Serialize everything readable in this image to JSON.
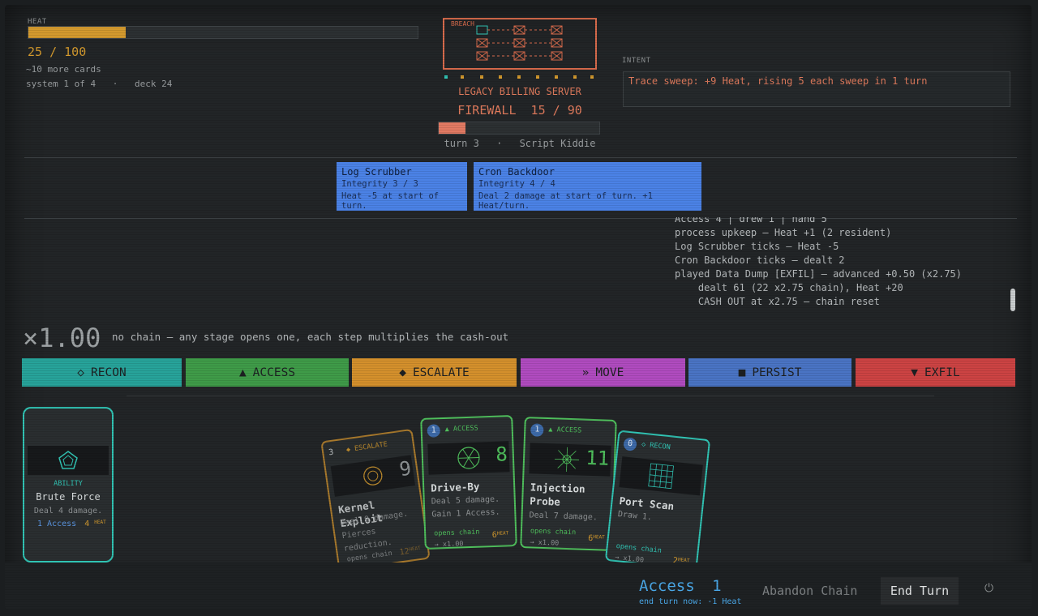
{
  "heat": {
    "label": "HEAT",
    "current": 25,
    "max": 100,
    "text": "25 / 100",
    "cards_left": "~10 more cards",
    "system": "system 1 of 4",
    "deck": "deck 24",
    "sep": "·"
  },
  "target": {
    "breach_label": "BREACH",
    "name": "LEGACY BILLING SERVER",
    "firewall_text": "FIREWALL  15 / 90",
    "firewall_current": 15,
    "firewall_max": 90,
    "turn": "turn 3",
    "difficulty": "Script Kiddie",
    "sep": "·"
  },
  "intent": {
    "label": "INTENT",
    "text": "Trace sweep: +9 Heat, rising 5 each sweep in 1 turn"
  },
  "residents": [
    {
      "name": "Log Scrubber",
      "integrity": "Integrity 3 / 3",
      "effect": "Heat -5 at start of turn."
    },
    {
      "name": "Cron Backdoor",
      "integrity": "Integrity 4 / 4",
      "effect": "Deal 2 damage at start of turn. +1 Heat/turn."
    }
  ],
  "log": [
    "Access 4 | drew 1 | hand 5",
    "process upkeep — Heat +1 (2 resident)",
    "Log Scrubber ticks — Heat -5",
    "Cron Backdoor ticks — dealt 2",
    "played Data Dump [EXFIL] — advanced +0.50 (x2.75)",
    "    dealt 61 (22 x2.75 chain), Heat +20",
    "    CASH OUT at x2.75 — chain reset"
  ],
  "chain": {
    "multiplier": "×1.00",
    "hint": "no chain — any stage opens one, each step multiplies the cash-out"
  },
  "stages": [
    {
      "icon": "◇",
      "label": "RECON",
      "color": "#27a39a"
    },
    {
      "icon": "▲",
      "label": "ACCESS",
      "color": "#3f9b48"
    },
    {
      "icon": "◆",
      "label": "ESCALATE",
      "color": "#d4902c"
    },
    {
      "icon": "»",
      "label": "MOVE",
      "color": "#b04bbf"
    },
    {
      "icon": "■",
      "label": "PERSIST",
      "color": "#4a74c4"
    },
    {
      "icon": "▼",
      "label": "EXFIL",
      "color": "#cc4343"
    }
  ],
  "ability": {
    "tag": "ABILITY",
    "name": "Brute Force",
    "desc": "Deal 4 damage.",
    "cost": "1 Access",
    "heat": "4",
    "heat_label": "HEAT"
  },
  "hand": [
    {
      "cost": "3",
      "stage": "◆ ESCALATE",
      "dmg": "9",
      "name": "Kernel Exploit",
      "desc": [
        "Deal 9 damage.",
        "Pierces",
        "reduction."
      ],
      "open": "opens chain",
      "mult": "x1.00",
      "heat": "12",
      "heat_label": "HEAT",
      "color": "#c0882e"
    },
    {
      "cost": "1",
      "stage": "▲ ACCESS",
      "dmg": "8",
      "name": "Drive-By",
      "desc": [
        "Deal 5 damage.",
        "Gain 1 Access."
      ],
      "open": "opens chain",
      "mult": "→ x1.00",
      "heat": "6",
      "heat_label": "HEAT",
      "color": "#4fbf5c"
    },
    {
      "cost": "1",
      "stage": "▲ ACCESS",
      "dmg": "11",
      "name": "Injection Probe",
      "desc": [
        "Deal 7 damage."
      ],
      "open": "opens chain",
      "mult": "→ x1.00",
      "heat": "6",
      "heat_label": "HEAT",
      "color": "#4fbf5c"
    },
    {
      "cost": "0",
      "stage": "◇ RECON",
      "dmg": "",
      "name": "Port Scan",
      "desc": [
        "Draw 1."
      ],
      "open": "opens chain",
      "mult": "→ x1.00",
      "heat": "2",
      "heat_label": "HEAT",
      "color": "#31c4b4"
    }
  ],
  "footer": {
    "access_label": "Access",
    "access_value": "1",
    "end_turn_note": "end turn now: -1 Heat",
    "abandon": "Abandon Chain",
    "end_turn": "End Turn",
    "power_icon": "⏻"
  }
}
